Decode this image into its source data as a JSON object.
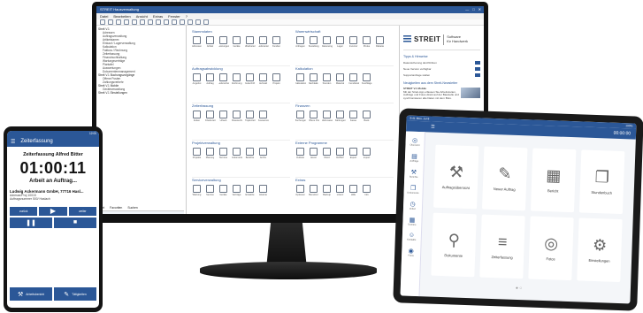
{
  "monitor": {
    "window_title": "STREIT Hausverwaltung",
    "window_controls": [
      "—",
      "□",
      "✕"
    ],
    "menu": [
      "Datei",
      "Bearbeiten",
      "Ansicht",
      "Extras",
      "Fenster",
      "?"
    ],
    "toolbar_icons": 14,
    "tree": [
      {
        "label": "Streit V.1",
        "sub": false
      },
      {
        "label": "Adressen",
        "sub": true
      },
      {
        "label": "Auftragsverwaltung",
        "sub": true
      },
      {
        "label": "Artikelstamm",
        "sub": true
      },
      {
        "label": "Einkauf / Lagerverwaltung",
        "sub": true
      },
      {
        "label": "Kalkulation",
        "sub": true
      },
      {
        "label": "Faktura / Rechnung",
        "sub": true
      },
      {
        "label": "Zeiterfassung",
        "sub": true
      },
      {
        "label": "Finanzbuchhaltung",
        "sub": true
      },
      {
        "label": "Wartungsverträge",
        "sub": true
      },
      {
        "label": "Plantafel",
        "sub": true
      },
      {
        "label": "Auswertungen",
        "sub": true
      },
      {
        "label": "Dokumentenmanagement",
        "sub": true
      },
      {
        "label": "Streit V.1 Buchungsvorgänge",
        "sub": false
      },
      {
        "label": "Offene Posten",
        "sub": true
      },
      {
        "label": "Zahlungsverkehr",
        "sub": true
      },
      {
        "label": "Streit V.1 Mobile",
        "sub": false
      },
      {
        "label": "Geräteverwaltung",
        "sub": true
      },
      {
        "label": "Streit V.1 Einstellungen",
        "sub": false
      }
    ],
    "tree_tabs": [
      "Start",
      "Favoriten",
      "Suchen"
    ],
    "modules": [
      {
        "title": "Stammdaten",
        "icons": [
          "Adressen",
          "Artikel",
          "Leistungen",
          "Geräte",
          "Mitarbeiter",
          "Lieferanten",
          "Kunden"
        ]
      },
      {
        "title": "Warenwirtschaft",
        "icons": [
          "Anfragen",
          "Bestellung",
          "Wareneingang",
          "Lager",
          "Inventur",
          "Preise",
          "Rabatte"
        ]
      },
      {
        "title": "Auftragsabwicklung",
        "icons": [
          "Angebot",
          "Auftrag",
          "Lieferschein",
          "Rechnung",
          "Gutschrift",
          "Aufmaß",
          "Projekt"
        ]
      },
      {
        "title": "Kalkulation",
        "icons": [
          "Kalkulation",
          "Nachkalk.",
          "Stunden",
          "Material",
          "Fremdleistung",
          "Zuschläge"
        ]
      },
      {
        "title": "Zeiterfassung",
        "icons": [
          "Zeiten",
          "Arbeitszeit",
          "Urlaub",
          "Abwesenheit",
          "Projektzeit",
          "Auswertung"
        ]
      },
      {
        "title": "Finanzen",
        "icons": [
          "Buchungen",
          "Offene Posten",
          "Mahnwesen",
          "Zahlungen",
          "Kasse",
          "Bank"
        ]
      },
      {
        "title": "Projektverwaltung",
        "icons": [
          "Projekte",
          "Planung",
          "Termine",
          "Dokumente",
          "Berichte",
          "Archiv"
        ]
      },
      {
        "title": "Externe Programme",
        "icons": [
          "Outlook",
          "Excel",
          "Word",
          "DATEV",
          "Export",
          "Import"
        ]
      },
      {
        "title": "Serviceverwaltung",
        "icons": [
          "Wartung",
          "Service",
          "Geräte",
          "Verträge",
          "Einsätze",
          "Historie"
        ]
      },
      {
        "title": "Extras",
        "icons": [
          "Optionen",
          "Benutzer",
          "Backup",
          "Lizenz",
          "Hilfe",
          "Info"
        ]
      }
    ],
    "right_panel": {
      "brand": "STREIT",
      "tagline_1": "Software",
      "tagline_2": "für Handwerk",
      "section_1": "Tipps & Hinweise",
      "rows": [
        "Datensicherung durchführen",
        "Neue Version verfügbar",
        "Supportanfrage stellen"
      ],
      "section_2": "Neuigkeiten aus dem Streit-Newsletter",
      "news_title": "STREIT V.1 Mobile",
      "news_text": "Mit der Streit-App erfassen Sie Arbeitszeiten, Aufträge und Fotos direkt auf der Baustelle und synchronisieren alle Daten mit dem Büro."
    }
  },
  "phone": {
    "status": "12:00",
    "appbar_title": "Zeiterfassung",
    "user_title": "Zeiterfassung Alfred Bitter",
    "timer": "01:00:11",
    "activity": "Arbeit an Auftrag...",
    "company": "Ludwig Ackermann GmbH, 77716 Hasl...",
    "address": "Adresse/Proj 10015",
    "project": "Auftragsnummer 500/ Haslach",
    "btn_back": "zurück",
    "btn_play": "▶",
    "btn_next": "weiter",
    "btn_pause": "❚❚",
    "btn_stop": "■",
    "action_1": "Arbeitsbericht",
    "action_2": "Tätigkeiten"
  },
  "tablet": {
    "status_left": "9:41  Mon. Jul 8",
    "status_right": "100%",
    "appbar_left": "☰",
    "appbar_right": "00:00:00",
    "rail": [
      "Übersicht",
      "Aufträge",
      "Berichte",
      "Dokumente",
      "Zeiten",
      "Termine",
      "Kontakte",
      "Fotos"
    ],
    "tiles": [
      {
        "label": "Auftragsübersicht",
        "glyph": "⚒"
      },
      {
        "label": "Neuer Auftrag",
        "glyph": "✎"
      },
      {
        "label": "Bericht",
        "glyph": "▦"
      },
      {
        "label": "Stundenbuch",
        "glyph": "❐"
      },
      {
        "label": "Dokumente",
        "glyph": "⚲"
      },
      {
        "label": "Zeiterfassung",
        "glyph": "≡"
      },
      {
        "label": "Fotos",
        "glyph": "◎"
      },
      {
        "label": "Einstellungen",
        "glyph": "⚙"
      }
    ],
    "page_dots": "● ○"
  },
  "colors": {
    "accent": "#2b5797",
    "device_frame": "#141414"
  }
}
